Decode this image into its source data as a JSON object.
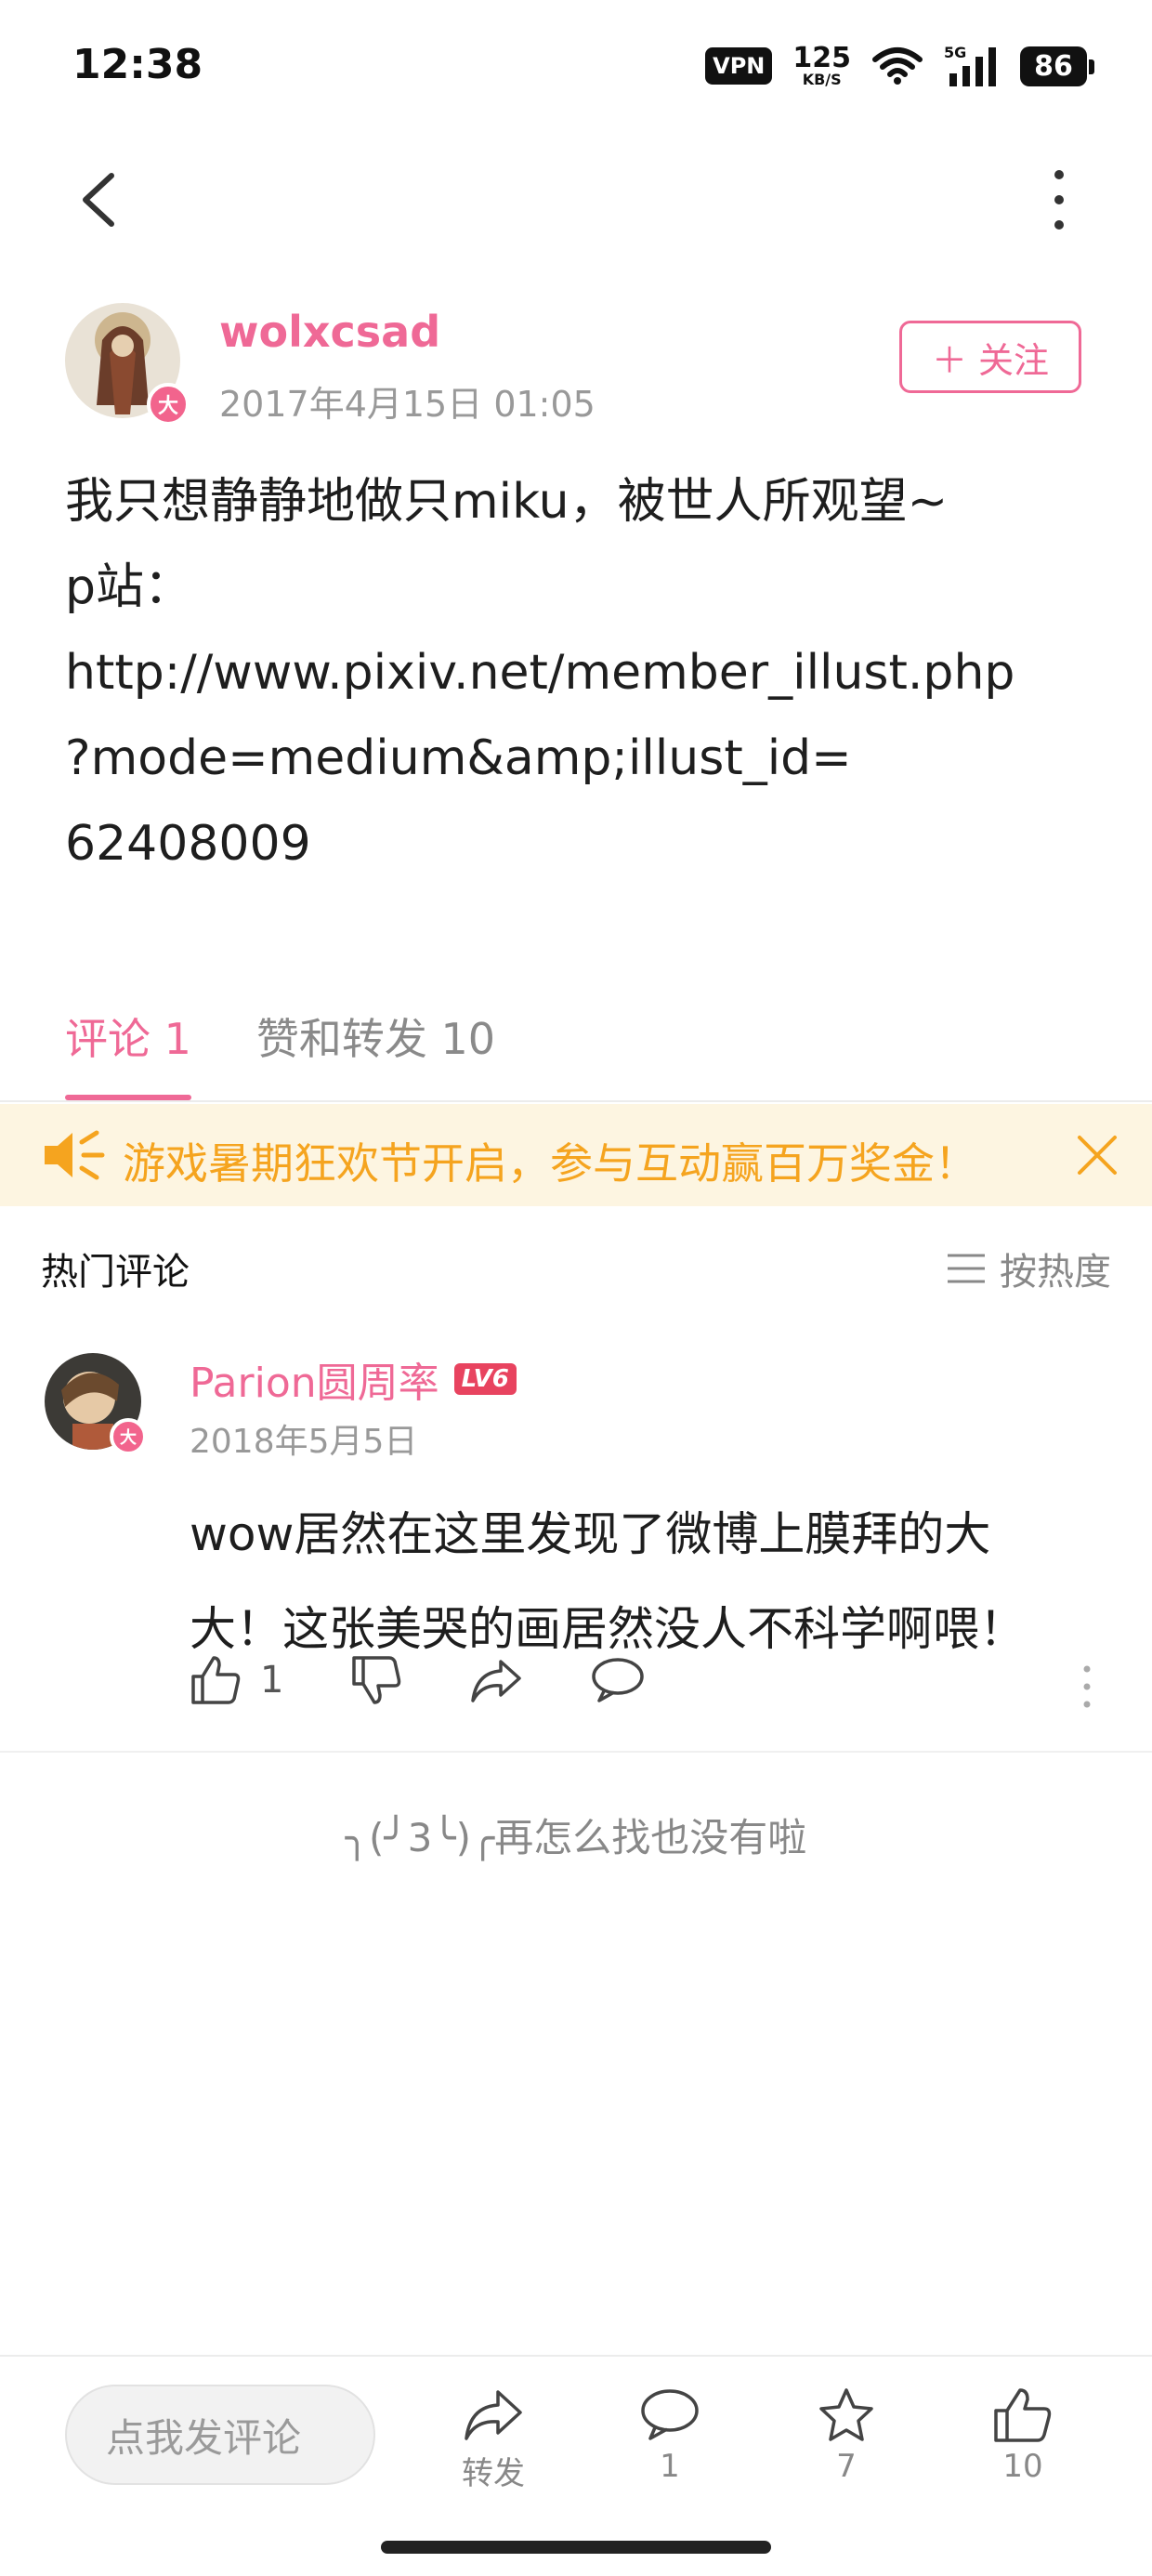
{
  "status_bar": {
    "time": "12:38",
    "vpn": "VPN",
    "speed_value": "125",
    "speed_unit": "KB/S",
    "network": "5G",
    "battery": "86"
  },
  "post": {
    "author": "wolxcsad",
    "time": "2017年4月15日 01:05",
    "follow_label": "＋ 关注",
    "badge": "大",
    "content": "我只想静静地做只miku，被世人所观望~\np站：\nhttp://www.pixiv.net/member_illust.php\n?mode=medium&amp;illust_id=\n62408009"
  },
  "tabs": [
    {
      "label": "评论 1",
      "active": true
    },
    {
      "label": "赞和转发 10",
      "active": false
    }
  ],
  "banner": {
    "text": "游戏暑期狂欢节开启，参与互动赢百万奖金！"
  },
  "comments_header": {
    "title": "热门评论",
    "sort_label": "按热度"
  },
  "comments": [
    {
      "user": "Parion圆周率",
      "level": "LV6",
      "badge": "大",
      "date": "2018年5月5日",
      "text": "wow居然在这里发现了微博上膜拜的大大！这张美哭的画居然没人不科学啊喂！",
      "likes": "1"
    }
  ],
  "end_text": "╮(╯3╰)╭再怎么找也没有啦",
  "bottom_bar": {
    "input_placeholder": "点我发评论",
    "repost_label": "转发",
    "comment_count": "1",
    "favorite_count": "7",
    "like_count": "10"
  },
  "colors": {
    "accent": "#ef6996",
    "banner_bg": "#fdf5e1",
    "banner_text": "#f5a41f",
    "level_badge": "#e8435f"
  }
}
